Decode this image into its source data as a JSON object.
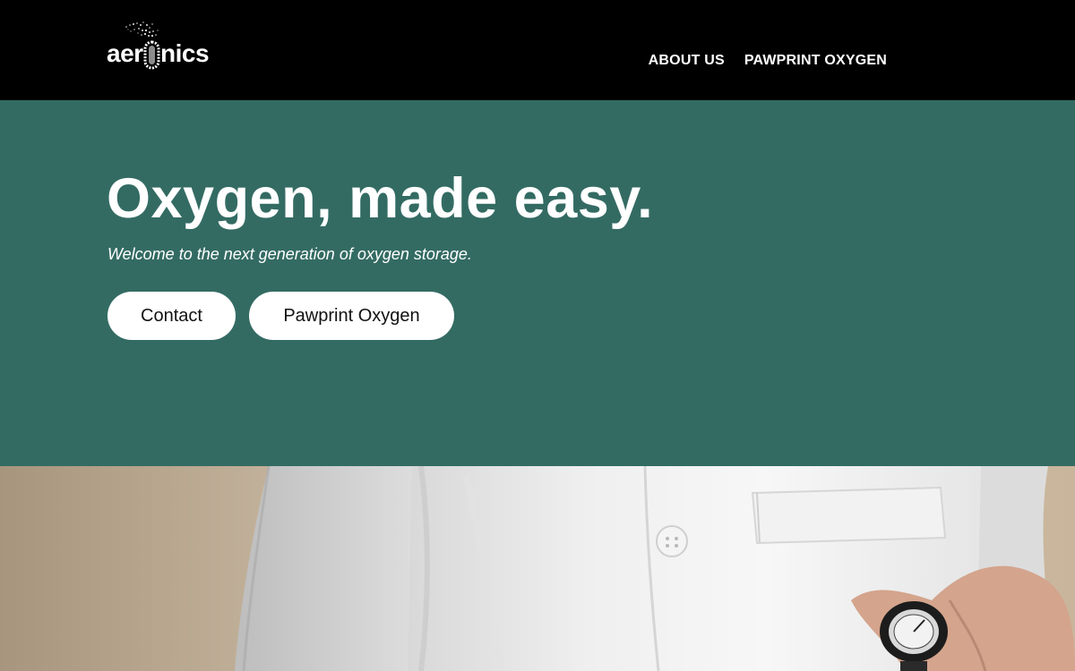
{
  "header": {
    "logo_text": "aeronics",
    "nav": [
      {
        "label": "ABOUT US"
      },
      {
        "label": "PAWPRINT OXYGEN"
      }
    ]
  },
  "hero": {
    "title": "Oxygen, made easy.",
    "subtitle": "Welcome to the next generation of oxygen storage.",
    "buttons": [
      {
        "label": "Contact"
      },
      {
        "label": "Pawprint Oxygen"
      }
    ]
  },
  "colors": {
    "header_bg": "#000000",
    "hero_bg": "#336b63",
    "button_bg": "#ffffff"
  }
}
